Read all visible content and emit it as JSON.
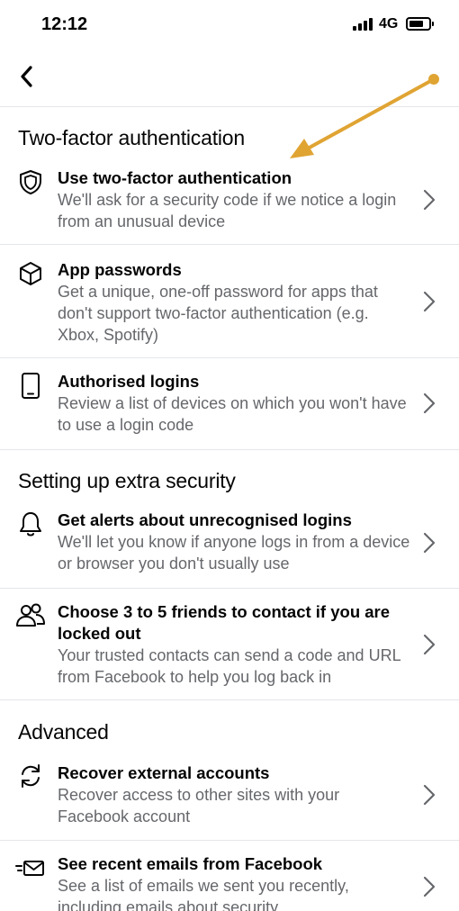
{
  "status_bar": {
    "time": "12:12",
    "network": "4G"
  },
  "nav": {
    "back_icon": "chevron-left-icon"
  },
  "annotation": {
    "color": "#e0a433"
  },
  "sections": {
    "two_factor": {
      "title": "Two-factor authentication",
      "items": [
        {
          "icon": "shield-icon",
          "title": "Use two-factor authentication",
          "desc": "We'll ask for a security code if we notice a login from an unusual device"
        },
        {
          "icon": "cube-icon",
          "title": "App passwords",
          "desc": "Get a unique, one-off password for apps that don't support two-factor authentication (e.g. Xbox, Spotify)"
        },
        {
          "icon": "phone-icon",
          "title": "Authorised logins",
          "desc": "Review a list of devices on which you won't have to use a login code"
        }
      ]
    },
    "extra_security": {
      "title": "Setting up extra security",
      "items": [
        {
          "icon": "bell-icon",
          "title": "Get alerts about unrecognised logins",
          "desc": "We'll let you know if anyone logs in from a device or browser you don't usually use"
        },
        {
          "icon": "people-icon",
          "title": "Choose 3 to 5 friends to contact if you are locked out",
          "desc": "Your trusted contacts can send a code and URL from Facebook to help you log back in"
        }
      ]
    },
    "advanced": {
      "title": "Advanced",
      "items": [
        {
          "icon": "refresh-icon",
          "title": "Recover external accounts",
          "desc": "Recover access to other sites with your Facebook account"
        },
        {
          "icon": "email-icon",
          "title": "See recent emails from Facebook",
          "desc": "See a list of emails we sent you recently, including emails about security"
        }
      ]
    }
  }
}
